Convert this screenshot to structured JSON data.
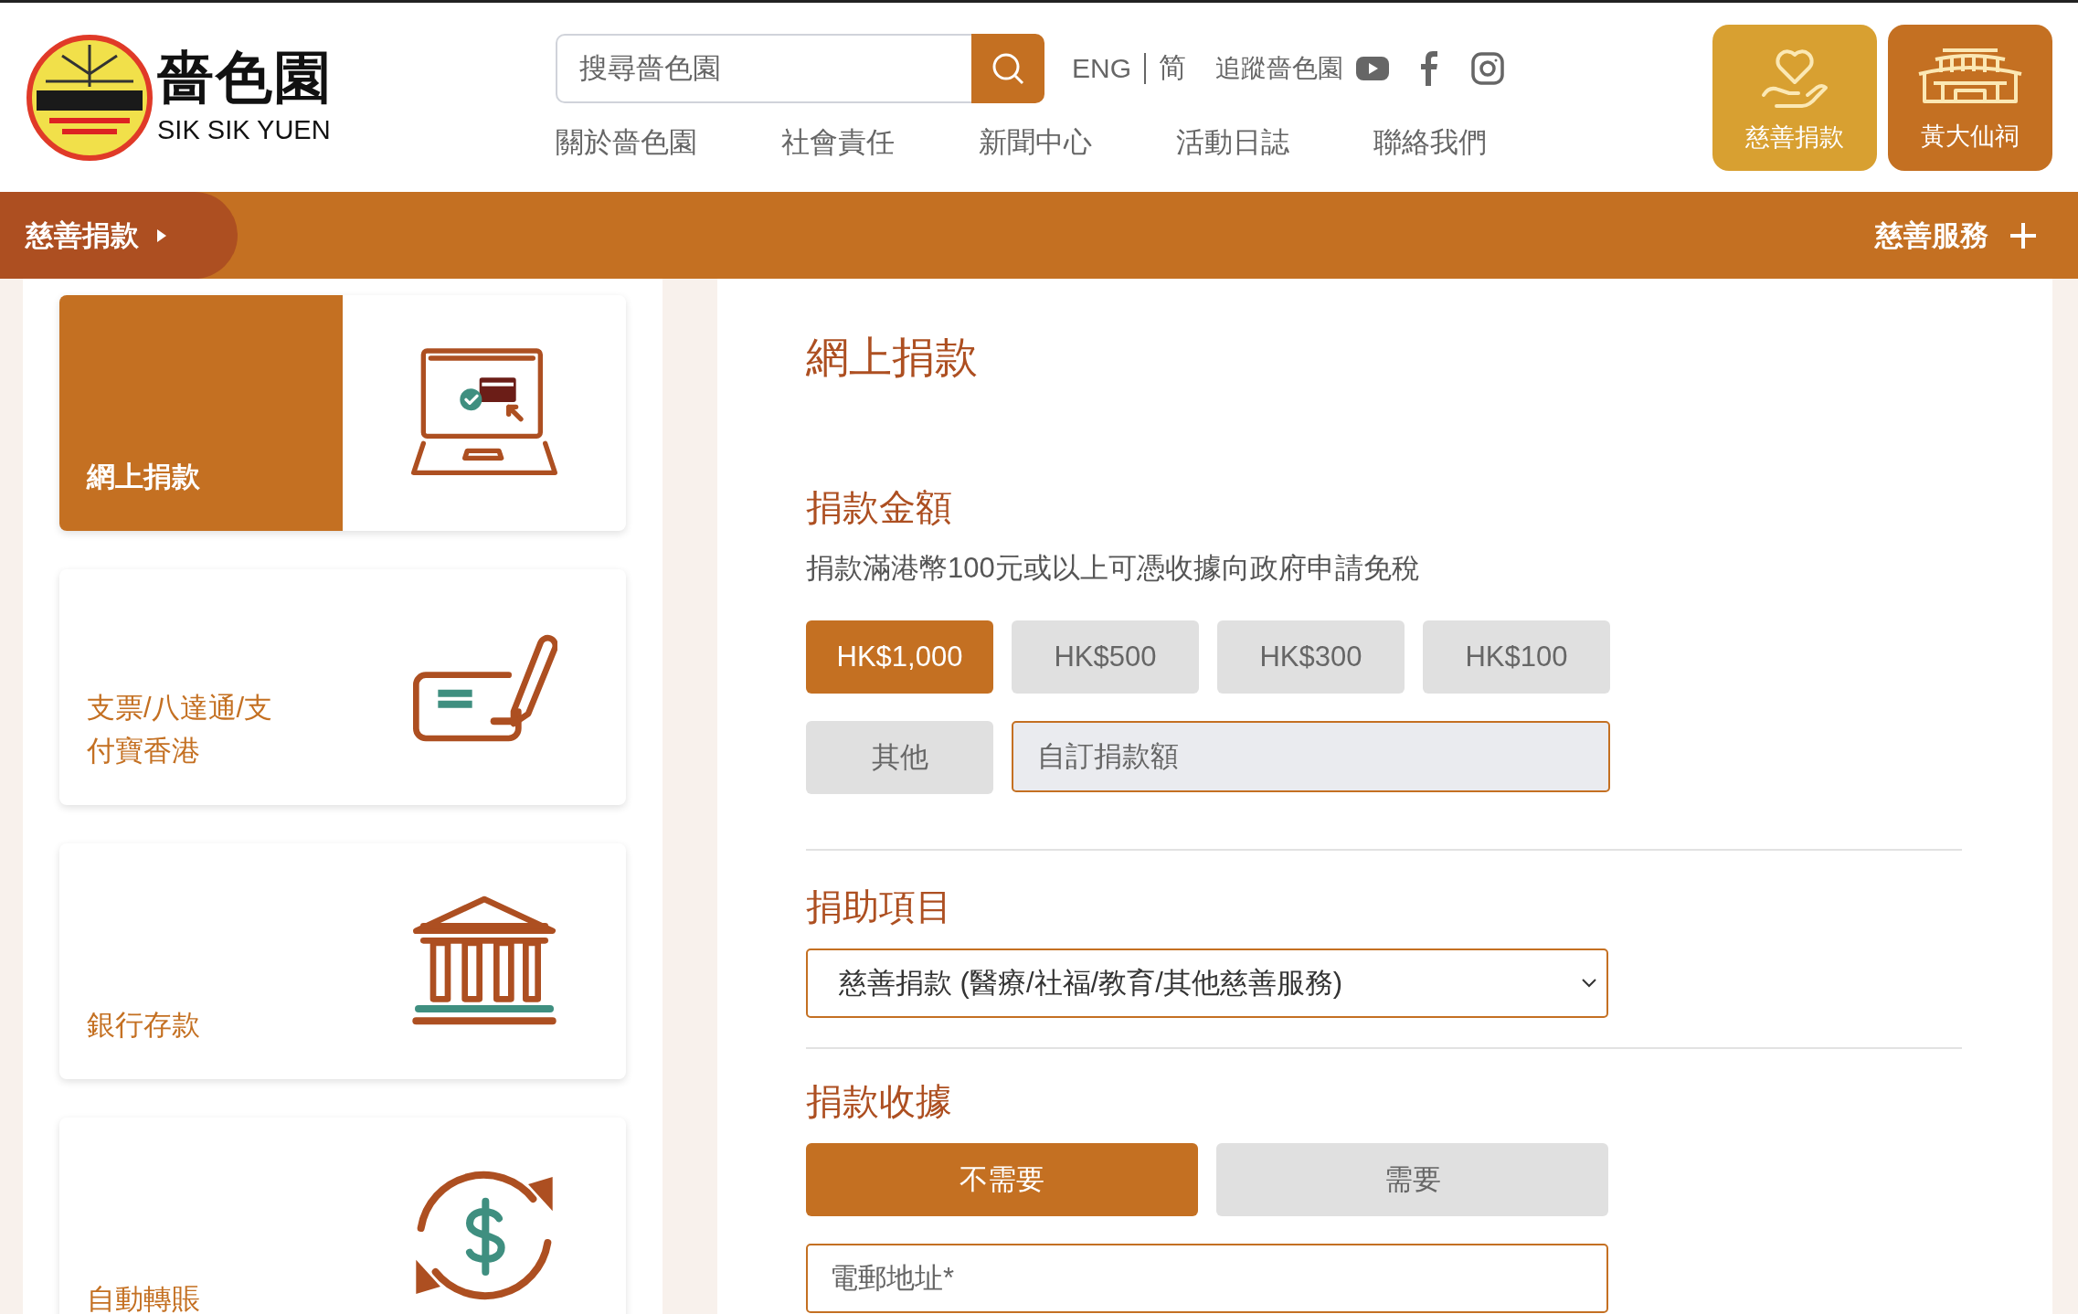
{
  "logo": {
    "title": "嗇色園",
    "subtitle": "SIK SIK YUEN"
  },
  "search": {
    "placeholder": "搜尋嗇色園"
  },
  "language_links": [
    "ENG",
    "简"
  ],
  "follow_label": "追蹤嗇色園",
  "nav": [
    "關於嗇色園",
    "社會責任",
    "新聞中心",
    "活動日誌",
    "聯絡我們"
  ],
  "quick_buttons": [
    {
      "label": "慈善捐款",
      "kind": "donate"
    },
    {
      "label": "黃大仙祠",
      "kind": "temple"
    }
  ],
  "breadcrumb": {
    "label": "慈善捐款"
  },
  "services_menu": {
    "label": "慈善服務",
    "expanded": false
  },
  "payment_methods": [
    {
      "label": "網上捐款",
      "kind": "online",
      "selected": true
    },
    {
      "label": "支票/八達通/支付寶香港",
      "kind": "cheque",
      "selected": false
    },
    {
      "label": "銀行存款",
      "kind": "bank",
      "selected": false
    },
    {
      "label": "自動轉賬",
      "kind": "autopay",
      "selected": false
    }
  ],
  "form": {
    "title": "網上捐款",
    "amount": {
      "heading": "捐款金額",
      "note": "捐款滿港幣100元或以上可憑收據向政府申請免稅",
      "options": [
        {
          "label": "HK$1,000",
          "selected": true
        },
        {
          "label": "HK$500",
          "selected": false
        },
        {
          "label": "HK$300",
          "selected": false
        },
        {
          "label": "HK$100",
          "selected": false
        }
      ],
      "other": {
        "label": "其他",
        "selected": false
      },
      "custom": {
        "placeholder": "自訂捐款額"
      }
    },
    "project": {
      "heading": "捐助項目",
      "value": "慈善捐款 (醫療/社福/教育/其他慈善服務)"
    },
    "receipt": {
      "heading": "捐款收據",
      "options": [
        {
          "label": "不需要",
          "selected": true
        },
        {
          "label": "需要",
          "selected": false
        }
      ]
    },
    "email": {
      "placeholder": "電郵地址*"
    }
  }
}
